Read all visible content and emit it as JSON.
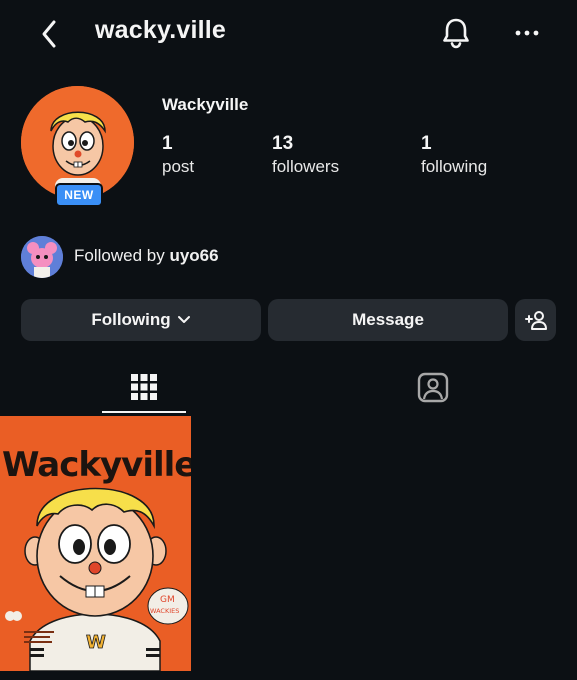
{
  "header": {
    "username": "wacky.ville"
  },
  "profile": {
    "display_name": "Wackyville",
    "badge": "NEW",
    "stats": [
      {
        "number": "1",
        "label": "post"
      },
      {
        "number": "13",
        "label": "followers"
      },
      {
        "number": "1",
        "label": "following"
      }
    ]
  },
  "followed_by": {
    "prefix": "Followed by",
    "user": "uyo66"
  },
  "actions": {
    "following": "Following",
    "message": "Message"
  },
  "tabs": {
    "grid": "grid-icon",
    "tagged": "tagged-icon"
  },
  "post": {
    "title": "Wackyville",
    "bubble_line1": "GM",
    "bubble_line2": "WACKIES",
    "shirt_letter": "W"
  },
  "colors": {
    "background": "#0c1014",
    "button": "#262b31",
    "badge": "#3a8ff6",
    "brand_orange": "#ea5e25"
  }
}
